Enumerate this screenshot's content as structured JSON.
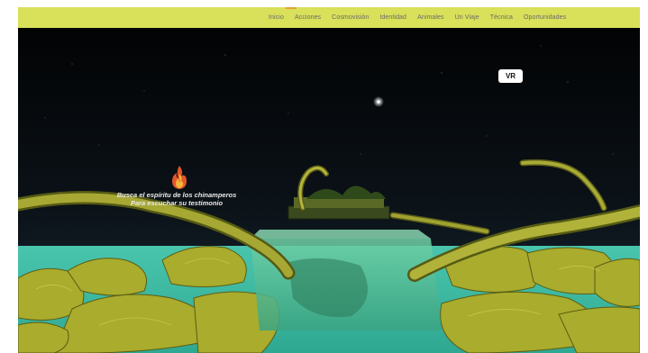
{
  "nav": {
    "items": [
      "Inicio",
      "Acciones",
      "Cosmovisión",
      "Identidad",
      "Animales",
      "Un Viaje",
      "Técnica",
      "Oportunidades"
    ],
    "active_index": 0
  },
  "scene": {
    "vr_button_label": "VR",
    "hint_line1": "Busca el espíritu de los chinamperos",
    "hint_line2": "Para escuchar su testimonio"
  },
  "colors": {
    "nav_bg": "#d9e05a",
    "nav_text": "#6a6a6a",
    "active_marker": "#e2a23a",
    "sky_top": "#020304",
    "sky_bottom": "#1c2a36",
    "water": "#40c0a8",
    "terrain": "#b8b830"
  },
  "icons": {
    "flame": "flame-icon"
  }
}
